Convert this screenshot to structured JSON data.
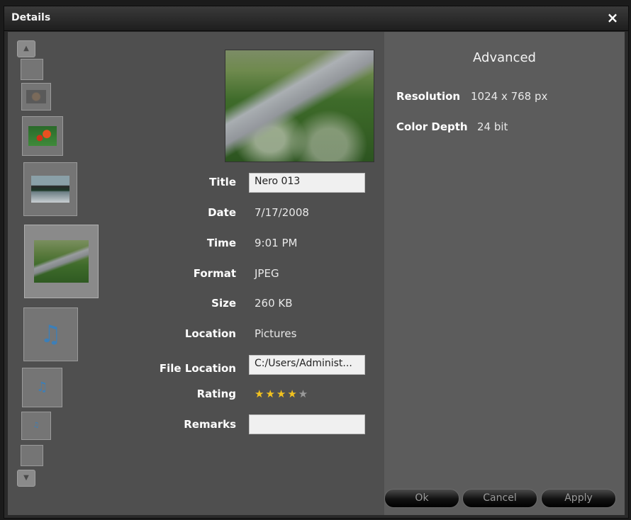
{
  "window": {
    "title": "Details",
    "close_icon": "×"
  },
  "thumbnails": {
    "scroll_up_icon": "▲",
    "scroll_down_icon": "▼",
    "items": [
      {
        "type": "blank"
      },
      {
        "type": "image",
        "name": "small-photo"
      },
      {
        "type": "image",
        "name": "flower-photo"
      },
      {
        "type": "image",
        "name": "lake-photo"
      },
      {
        "type": "image",
        "name": "stream-photo",
        "selected": true
      },
      {
        "type": "audio",
        "icon": "♫"
      },
      {
        "type": "audio",
        "icon": "♫"
      },
      {
        "type": "audio",
        "icon": "♫"
      },
      {
        "type": "blank"
      }
    ]
  },
  "details": {
    "title_label": "Title",
    "title_value": "Nero 013",
    "date_label": "Date",
    "date_value": "7/17/2008",
    "time_label": "Time",
    "time_value": "9:01 PM",
    "format_label": "Format",
    "format_value": "JPEG",
    "size_label": "Size",
    "size_value": "260 KB",
    "location_label": "Location",
    "location_value": "Pictures",
    "file_location_label": "File Location",
    "file_location_value": "C:/Users/Administ...",
    "rating_label": "Rating",
    "rating_value": 4,
    "rating_max": 5,
    "rating_on": "★★★★",
    "rating_off": "★",
    "remarks_label": "Remarks",
    "remarks_value": ""
  },
  "advanced": {
    "heading": "Advanced",
    "resolution_label": "Resolution",
    "resolution_value": "1024 x 768 px",
    "color_depth_label": "Color Depth",
    "color_depth_value": "24 bit"
  },
  "buttons": {
    "ok": "Ok",
    "cancel": "Cancel",
    "apply": "Apply"
  },
  "colors": {
    "star_on": "#f2c21f",
    "star_off": "#9a9a9a",
    "panel_left": "#4f4f4f",
    "panel_right": "#5c5c5c"
  }
}
